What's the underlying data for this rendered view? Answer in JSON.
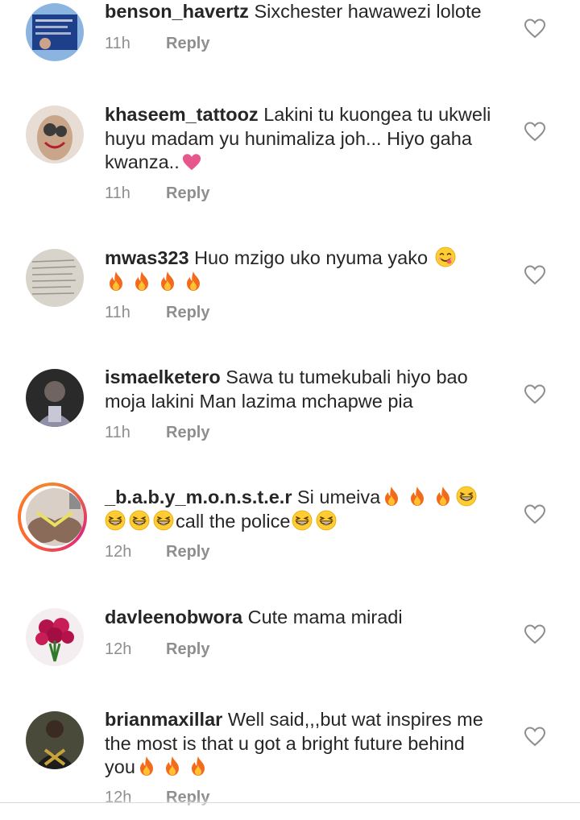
{
  "comments": [
    {
      "username": "benson_havertz",
      "body": "Sixchester hawawezi lolote",
      "time": "11h",
      "reply": "Reply",
      "avatar_colors": [
        "#1e3f8a",
        "#8cb4e0"
      ]
    },
    {
      "username": "khaseem_tattooz",
      "body": "Lakini tu kuongea tu ukweli huyu madam yu hunimaliza joh... Hiyo gaha kwanza..",
      "trailing_icon": "pink-heart-emoji",
      "time": "11h",
      "reply": "Reply",
      "avatar_colors": [
        "#c9a58a",
        "#3b3b3b"
      ]
    },
    {
      "username": "mwas323",
      "body": "Huo mzigo uko nyuma yako",
      "trailing_icon": "smiling-face-emoji",
      "line2_icons": [
        "fire-emoji",
        "fire-emoji",
        "fire-emoji",
        "fire-emoji"
      ],
      "time": "11h",
      "reply": "Reply",
      "avatar_colors": [
        "#d8d4cc",
        "#9a958a"
      ]
    },
    {
      "username": "ismaelketero",
      "body": "Sawa tu tumekubali hiyo bao moja lakini Man lazima mchapwe pia",
      "time": "11h",
      "reply": "Reply",
      "avatar_colors": [
        "#2a2a2a",
        "#6f6460"
      ]
    },
    {
      "username": "_b.a.b.y_m.o.n.s.t.e.r",
      "body_part1": "Si umeiva",
      "body_part2": "call the police",
      "icons_after_part1": [
        "fire-emoji",
        "fire-emoji",
        "fire-emoji",
        "grinning-squint-emoji"
      ],
      "icons_before_part2": [
        "grinning-squint-emoji",
        "grinning-squint-emoji",
        "grinning-squint-emoji"
      ],
      "icons_after_part2": [
        "grinning-squint-emoji",
        "grinning-squint-emoji"
      ],
      "time": "12h",
      "reply": "Reply",
      "has_story_ring": true,
      "avatar_colors": [
        "#8a6a58",
        "#e8e062"
      ]
    },
    {
      "username": "davleenobwora",
      "body": "Cute mama miradi",
      "time": "12h",
      "reply": "Reply",
      "avatar_colors": [
        "#b3124a",
        "#2f7a2a"
      ]
    },
    {
      "username": "brianmaxillar",
      "body": "Well said,,,but wat inspires me the most is that u got a bright future behind you",
      "trailing_icons": [
        "fire-emoji",
        "fire-emoji",
        "fire-emoji"
      ],
      "time": "12h",
      "reply": "Reply",
      "avatar_colors": [
        "#1d1d1d",
        "#c7a23a"
      ]
    }
  ],
  "colors": {
    "text": "#262626",
    "meta": "#8e8e8e",
    "heart_outline": "#8e8e8e"
  }
}
